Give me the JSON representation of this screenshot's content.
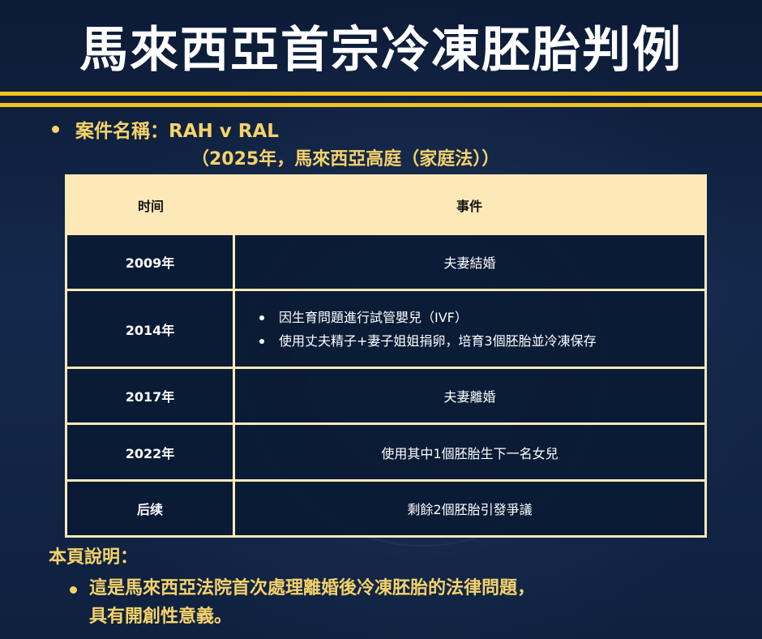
{
  "title": "馬來西亞首宗冷凍胚胎判例",
  "case": {
    "label": "案件名稱：RAH v RAL",
    "subtitle": "（2025年，馬來西亞高庭（家庭法））"
  },
  "table": {
    "headers": [
      "时间",
      "事件"
    ],
    "rows": [
      {
        "year": "2009年",
        "event": "夫妻結婚"
      },
      {
        "year": "2014年",
        "bullets": [
          "因生育問題進行試管嬰兒（IVF）",
          "使用丈夫精子+妻子姐姐捐卵，培育3個胚胎並冷凍保存"
        ]
      },
      {
        "year": "2017年",
        "event": "夫妻離婚"
      },
      {
        "year": "2022年",
        "event": "使用其中1個胚胎生下一名女兒"
      },
      {
        "year": "后续",
        "event": "剩餘2個胚胎引發爭議"
      }
    ]
  },
  "note": {
    "heading": "本頁說明：",
    "line1": "這是馬來西亞法院首次處理離婚後冷凍胚胎的法律問題，",
    "line2": "具有開創性意義。"
  },
  "colors": {
    "background": "#0e1f3e",
    "accent_gold": "#f3c21e",
    "text_gold": "#f5d36a",
    "table_header": "#fde9b8"
  }
}
